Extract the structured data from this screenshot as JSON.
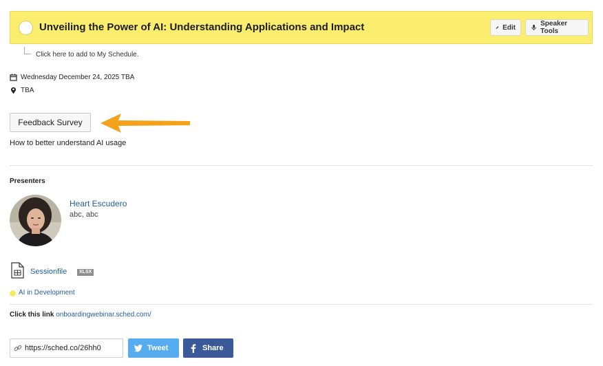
{
  "header": {
    "title": "Unveiling the Power of AI: Understanding Applications and Impact",
    "edit_label": "Edit",
    "speaker_tools_label": "Speaker Tools",
    "bg_color": "#fbee6f"
  },
  "schedule_hint": "Click here to add to My Schedule.",
  "meta": {
    "date": "Wednesday December 24, 2025 TBA",
    "location": "TBA"
  },
  "feedback_button": "Feedback Survey",
  "description": "How to better understand AI usage",
  "presenters": {
    "heading": "Presenters",
    "items": [
      {
        "name": "Heart Escudero",
        "role": "abc, abc"
      }
    ]
  },
  "file": {
    "label": "Sessionfile",
    "badge": "XLSX"
  },
  "track": {
    "label": "AI in Development",
    "color": "#f6ea5f"
  },
  "link_row": {
    "label": "Click this link",
    "url_text": "onboardingwebinar.sched.com/"
  },
  "share": {
    "url": "https://sched.co/26hh0",
    "tweet_label": "Tweet",
    "share_label": "Share",
    "twitter_color": "#55acee",
    "facebook_color": "#3b5998"
  },
  "accent_color": "#1f5f9c",
  "arrow_color": "#f4a21c"
}
